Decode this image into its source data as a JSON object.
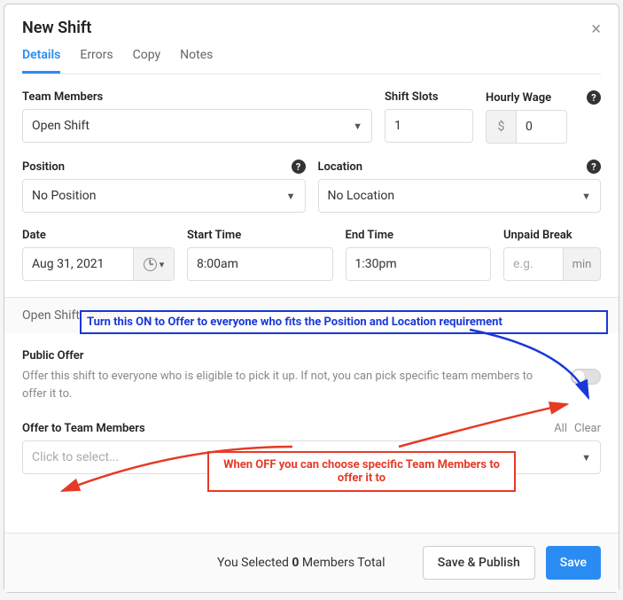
{
  "modal": {
    "title": "New Shift",
    "tabs": [
      "Details",
      "Errors",
      "Copy",
      "Notes"
    ]
  },
  "fields": {
    "team_members_label": "Team Members",
    "team_members_value": "Open Shift",
    "shift_slots_label": "Shift Slots",
    "shift_slots_value": "1",
    "hourly_wage_label": "Hourly Wage",
    "hourly_wage_prefix": "$",
    "hourly_wage_value": "0",
    "position_label": "Position",
    "position_value": "No Position",
    "location_label": "Location",
    "location_value": "No Location",
    "date_label": "Date",
    "date_value": "Aug 31, 2021",
    "start_label": "Start Time",
    "start_value": "8:00am",
    "end_label": "End Time",
    "end_value": "1:30pm",
    "break_label": "Unpaid Break",
    "break_placeholder": "e.g.",
    "break_suffix": "min"
  },
  "open_shift": {
    "section_title": "Open Shift Options",
    "public_offer_label": "Public Offer",
    "public_offer_desc": "Offer this shift to everyone who is eligible to pick it up. If not, you can pick specific team members to offer it to.",
    "offer_label": "Offer to Team Members",
    "offer_placeholder": "Click to select...",
    "link_all": "All",
    "link_clear": "Clear"
  },
  "annotations": {
    "blue": "Turn this ON to Offer to everyone who fits the Position and Location requirement",
    "red": "When OFF you can choose specific Team Members to offer it to"
  },
  "footer": {
    "summary_prefix": "You Selected ",
    "summary_count": "0",
    "summary_suffix": " Members Total",
    "save_publish": "Save & Publish",
    "save": "Save"
  }
}
